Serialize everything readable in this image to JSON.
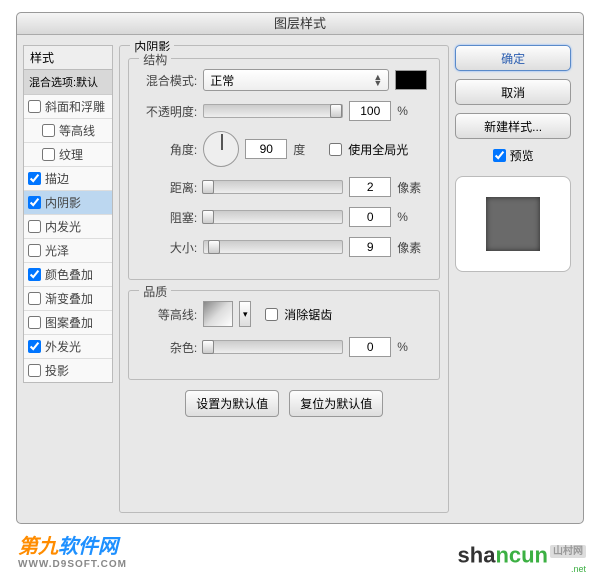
{
  "dialog": {
    "title": "图层样式",
    "styles_header": "样式",
    "blend_options": "混合选项:默认",
    "styles": [
      {
        "label": "斜面和浮雕",
        "checked": false,
        "indent": false
      },
      {
        "label": "等高线",
        "checked": false,
        "indent": true
      },
      {
        "label": "纹理",
        "checked": false,
        "indent": true
      },
      {
        "label": "描边",
        "checked": true,
        "indent": false
      },
      {
        "label": "内阴影",
        "checked": true,
        "indent": false,
        "selected": true
      },
      {
        "label": "内发光",
        "checked": false,
        "indent": false
      },
      {
        "label": "光泽",
        "checked": false,
        "indent": false
      },
      {
        "label": "颜色叠加",
        "checked": true,
        "indent": false
      },
      {
        "label": "渐变叠加",
        "checked": false,
        "indent": false
      },
      {
        "label": "图案叠加",
        "checked": false,
        "indent": false
      },
      {
        "label": "外发光",
        "checked": true,
        "indent": false
      },
      {
        "label": "投影",
        "checked": false,
        "indent": false
      }
    ]
  },
  "panel": {
    "title": "内阴影",
    "structure": {
      "legend": "结构",
      "blend_mode_label": "混合模式:",
      "blend_mode_value": "正常",
      "color": "#000000",
      "opacity_label": "不透明度:",
      "opacity": "100",
      "opacity_unit": "%",
      "angle_label": "角度:",
      "angle": "90",
      "angle_unit": "度",
      "global_light_label": "使用全局光",
      "global_light": false,
      "distance_label": "距离:",
      "distance": "2",
      "distance_unit": "像素",
      "choke_label": "阻塞:",
      "choke": "0",
      "choke_unit": "%",
      "size_label": "大小:",
      "size": "9",
      "size_unit": "像素"
    },
    "quality": {
      "legend": "品质",
      "contour_label": "等高线:",
      "antialias_label": "消除锯齿",
      "antialias": false,
      "noise_label": "杂色:",
      "noise": "0",
      "noise_unit": "%"
    },
    "set_default": "设置为默认值",
    "reset_default": "复位为默认值"
  },
  "buttons": {
    "ok": "确定",
    "cancel": "取消",
    "new_style": "新建样式...",
    "preview": "预览"
  },
  "watermarks": {
    "w1a": "第九",
    "w1b": "软件网",
    "w1url": "WWW.D9SOFT.COM",
    "w2a": "sha",
    "w2b": "ncun",
    "w2tag": "山村网",
    "w2url": ".net"
  }
}
